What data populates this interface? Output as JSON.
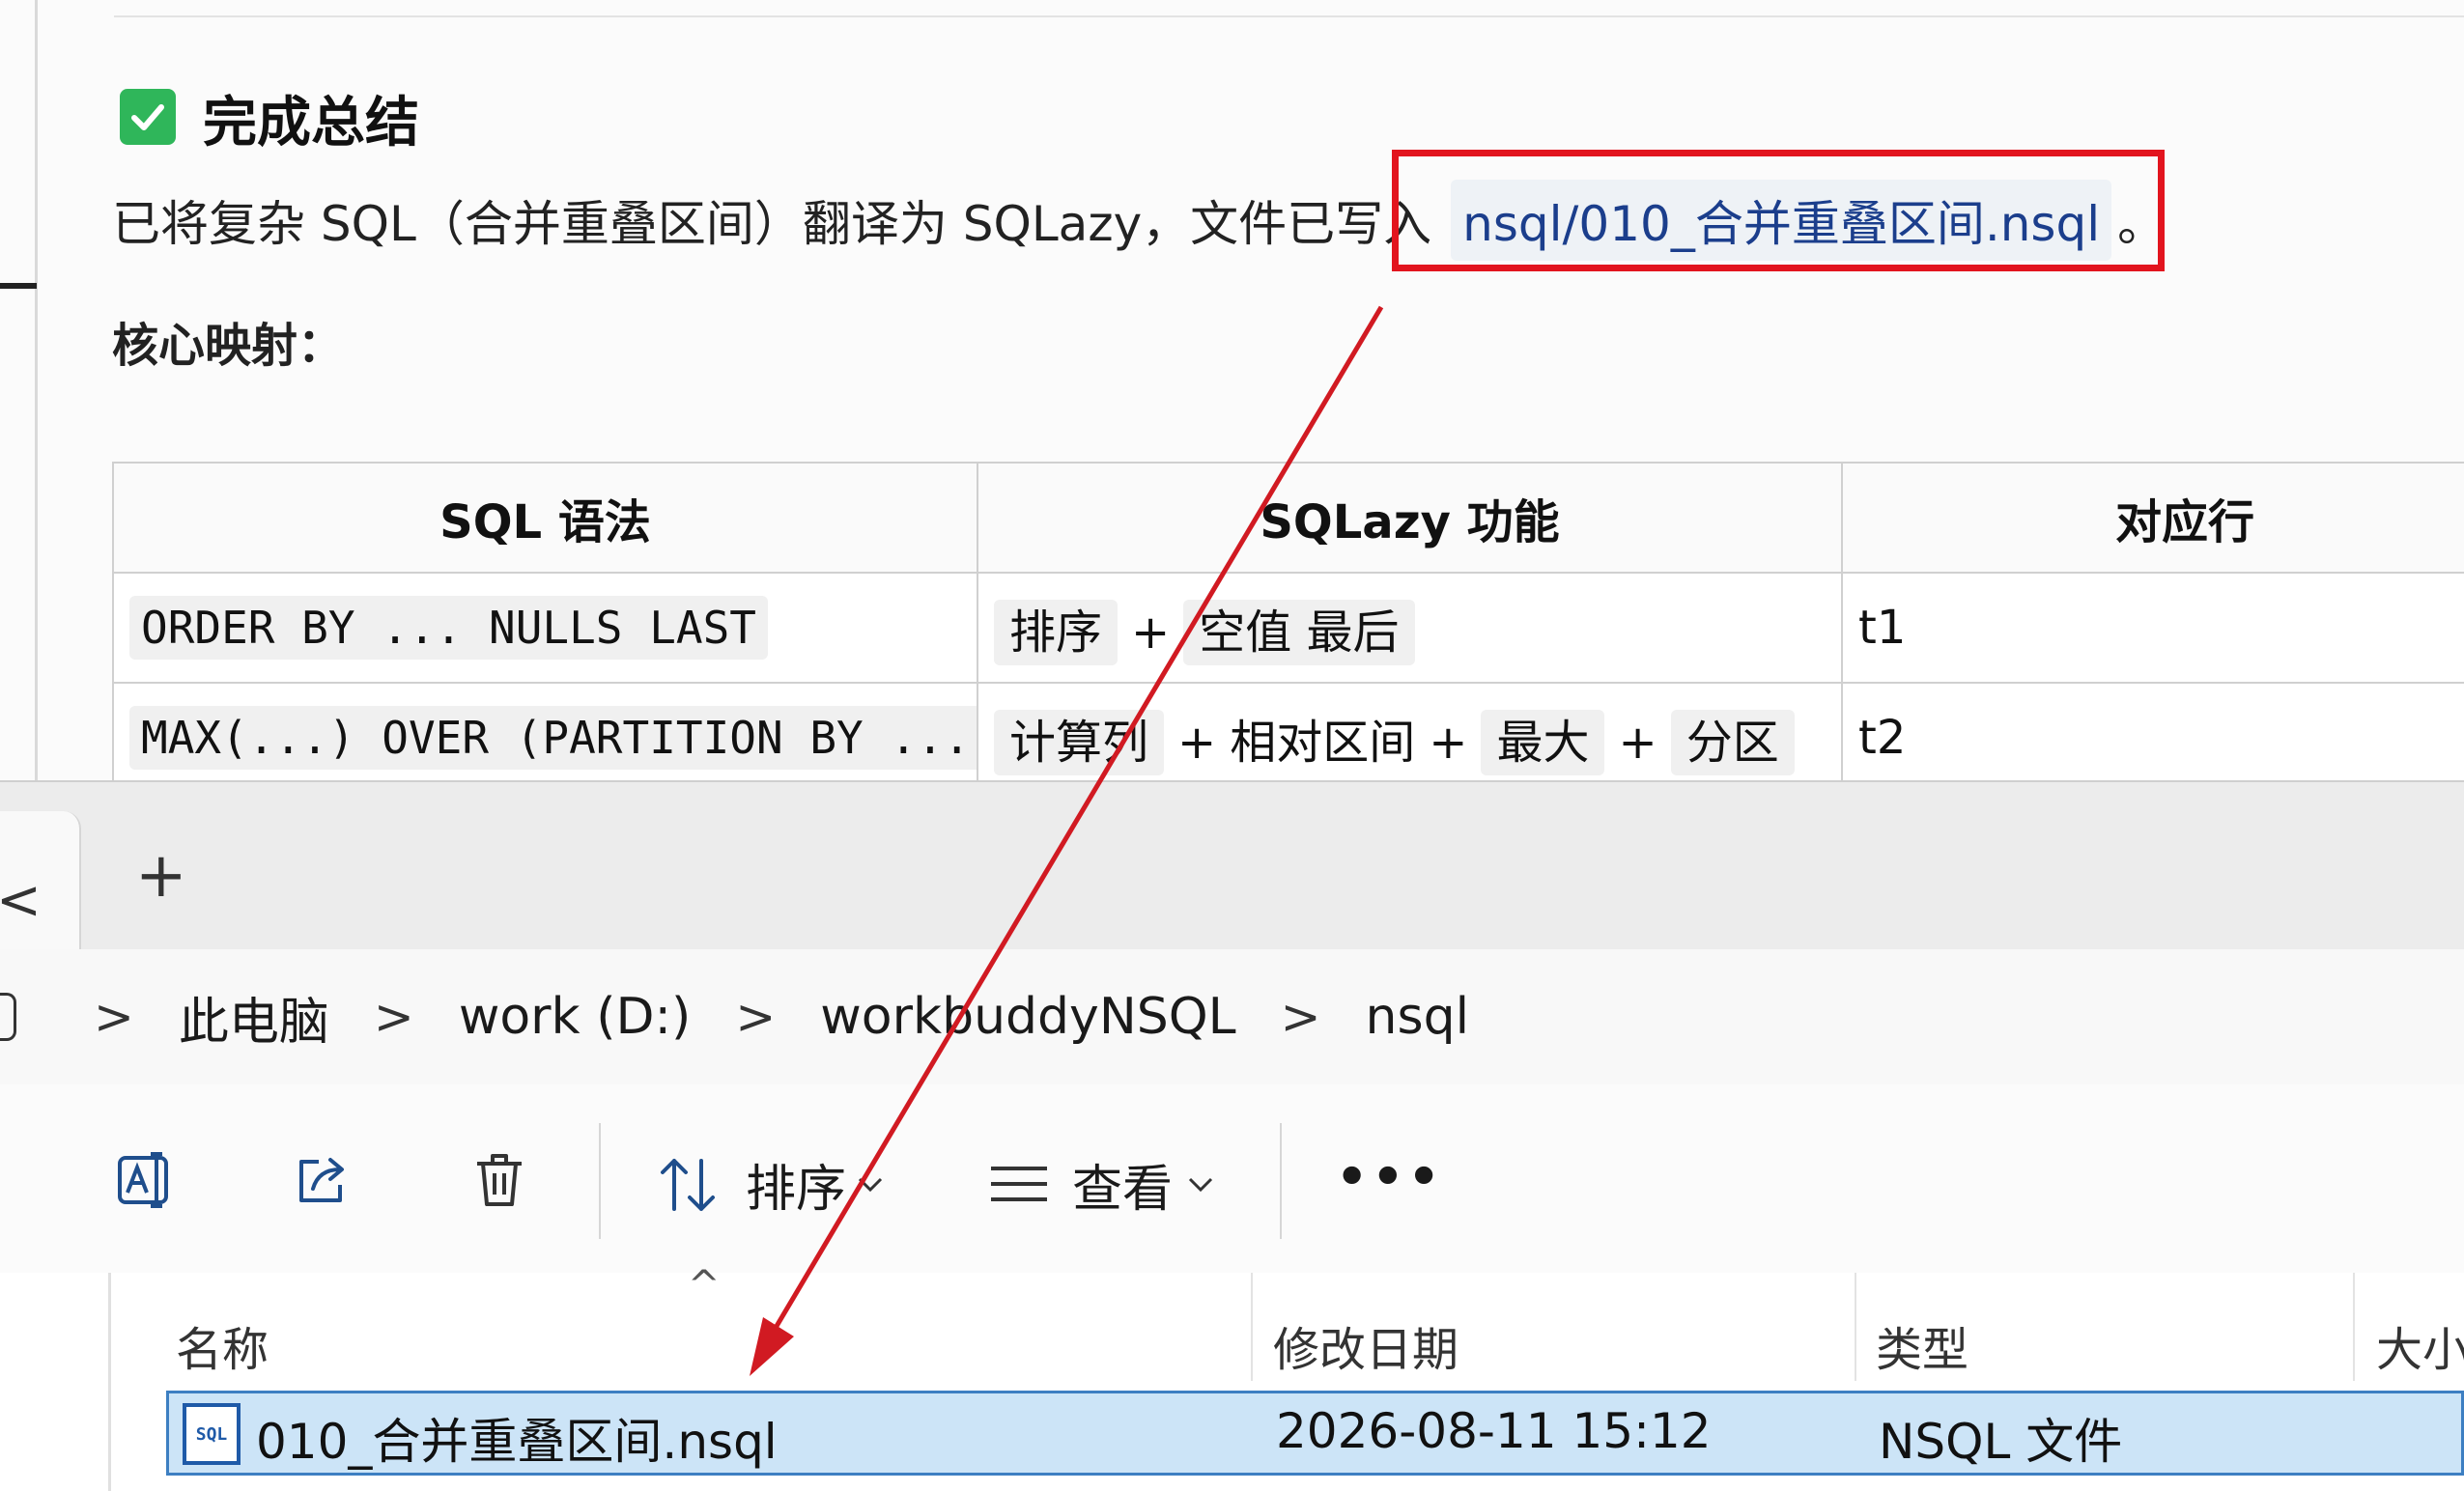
{
  "doc": {
    "heading": "完成总结",
    "summary_text": "已将复杂 SQL（合并重叠区间）翻译为 SQLazy，文件已写入",
    "summary_path": "nsql/010_合并重叠区间.nsql",
    "summary_end": "。",
    "subheading": "核心映射：",
    "table": {
      "headers": [
        "SQL 语法",
        "SQLazy 功能",
        "对应行"
      ],
      "rows": [
        {
          "sql": "ORDER BY ... NULLS LAST",
          "feature": [
            {
              "text": "排序",
              "chip": true
            },
            {
              "text": "+",
              "chip": false
            },
            {
              "text": "空值 最后",
              "chip": true
            }
          ],
          "line": "t1"
        },
        {
          "sql": "MAX(...) OVER (PARTITION BY ...",
          "feature": [
            {
              "text": "计算列",
              "chip": true
            },
            {
              "text": "+",
              "chip": false
            },
            {
              "text": "相对区间",
              "chip": false
            },
            {
              "text": "+",
              "chip": false
            },
            {
              "text": "最大",
              "chip": true
            },
            {
              "text": "+",
              "chip": false
            },
            {
              "text": "分区",
              "chip": true
            }
          ],
          "line": "t2"
        }
      ]
    }
  },
  "explorer": {
    "tabs": {
      "back_icon": "<",
      "add_label": "+"
    },
    "breadcrumb": [
      "此电脑",
      "work (D:)",
      "workbuddyNSQL",
      "nsql"
    ],
    "breadcrumb_separator": ">",
    "toolbar": {
      "sort_label": "排序",
      "view_label": "查看",
      "more_label": "•••"
    },
    "columns": [
      "名称",
      "修改日期",
      "类型",
      "大小"
    ],
    "files": [
      {
        "name": "010_合并重叠区间.nsql",
        "modified": "2026-08-11 15:12",
        "type": "NSQL 文件",
        "icon_text": "SQL"
      }
    ]
  },
  "colors": {
    "highlight_red": "#e2141e",
    "selected_row": "#cce4f7",
    "success_green": "#2fb65a",
    "link_blue": "#1b3e8c"
  }
}
